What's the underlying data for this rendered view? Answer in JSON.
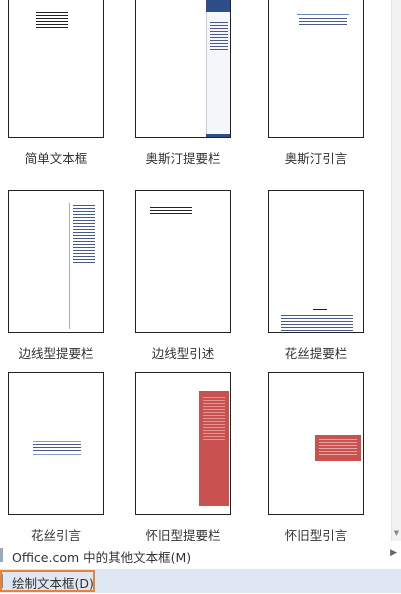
{
  "gallery": {
    "items": [
      {
        "label": "简单文本框"
      },
      {
        "label": "奥斯汀提要栏"
      },
      {
        "label": "奥斯汀引言"
      },
      {
        "label": "边线型提要栏"
      },
      {
        "label": "边线型引述"
      },
      {
        "label": "花丝提要栏"
      },
      {
        "label": "花丝引言"
      },
      {
        "label": "怀旧型提要栏"
      },
      {
        "label": "怀旧型引言"
      }
    ]
  },
  "menu": {
    "more_label": "Office.com 中的其他文本框(M)",
    "draw_label": "绘制文本框(D)"
  },
  "colors": {
    "accent_blue": "#2e4e8a",
    "retro_red": "#c9514f",
    "highlight": "#dfe7f3",
    "focus_border": "#e4813a"
  }
}
